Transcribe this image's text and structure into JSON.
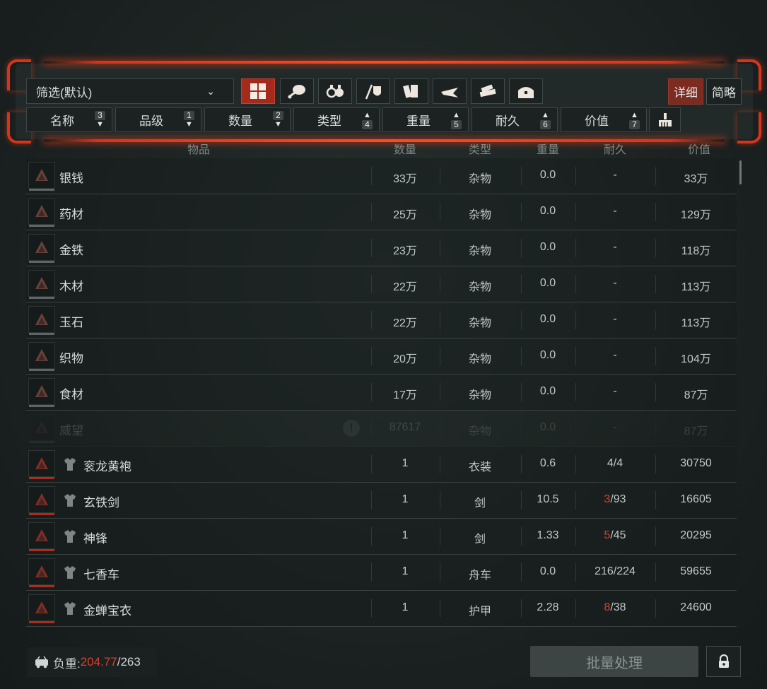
{
  "filter": {
    "selected": "筛选(默认)"
  },
  "categories": [
    {
      "icon": "all-grid-icon",
      "active": true
    },
    {
      "icon": "meat-icon",
      "active": false
    },
    {
      "icon": "potion-bottles-icon",
      "active": false
    },
    {
      "icon": "weapons-armor-icon",
      "active": false
    },
    {
      "icon": "books-scrolls-icon",
      "active": false
    },
    {
      "icon": "hidden-weapon-icon",
      "active": false
    },
    {
      "icon": "materials-icon",
      "active": false
    },
    {
      "icon": "treasure-chest-icon",
      "active": false
    }
  ],
  "view": {
    "detail": "详细",
    "brief": "简略",
    "active": "detail"
  },
  "sort_buttons": [
    {
      "label": "名称",
      "badge": "3",
      "badge_pos": "top",
      "arrow_pos": "bottom"
    },
    {
      "label": "品级",
      "badge": "1",
      "badge_pos": "top",
      "arrow_pos": "bottom"
    },
    {
      "label": "数量",
      "badge": "2",
      "badge_pos": "top",
      "arrow_pos": "bottom"
    },
    {
      "label": "类型",
      "badge": "4",
      "badge_pos": "bottom",
      "arrow_pos": "top"
    },
    {
      "label": "重量",
      "badge": "5",
      "badge_pos": "bottom",
      "arrow_pos": "top"
    },
    {
      "label": "耐久",
      "badge": "6",
      "badge_pos": "bottom",
      "arrow_pos": "top"
    },
    {
      "label": "价值",
      "badge": "7",
      "badge_pos": "bottom",
      "arrow_pos": "top"
    }
  ],
  "table": {
    "headers": {
      "item": "物品",
      "qty": "数量",
      "type": "类型",
      "weight": "重量",
      "durability": "耐久",
      "value": "价值"
    },
    "rows": [
      {
        "name": "银钱",
        "qty": "33万",
        "type": "杂物",
        "weight": "0.0",
        "dur_cur": "",
        "dur_rest": "-",
        "value": "33万",
        "equip": false,
        "dim": false,
        "red_bar": false
      },
      {
        "name": "药材",
        "qty": "25万",
        "type": "杂物",
        "weight": "0.0",
        "dur_cur": "",
        "dur_rest": "-",
        "value": "129万",
        "equip": false,
        "dim": false,
        "red_bar": false
      },
      {
        "name": "金铁",
        "qty": "23万",
        "type": "杂物",
        "weight": "0.0",
        "dur_cur": "",
        "dur_rest": "-",
        "value": "118万",
        "equip": false,
        "dim": false,
        "red_bar": false
      },
      {
        "name": "木材",
        "qty": "22万",
        "type": "杂物",
        "weight": "0.0",
        "dur_cur": "",
        "dur_rest": "-",
        "value": "113万",
        "equip": false,
        "dim": false,
        "red_bar": false
      },
      {
        "name": "玉石",
        "qty": "22万",
        "type": "杂物",
        "weight": "0.0",
        "dur_cur": "",
        "dur_rest": "-",
        "value": "113万",
        "equip": false,
        "dim": false,
        "red_bar": false
      },
      {
        "name": "织物",
        "qty": "20万",
        "type": "杂物",
        "weight": "0.0",
        "dur_cur": "",
        "dur_rest": "-",
        "value": "104万",
        "equip": false,
        "dim": false,
        "red_bar": false
      },
      {
        "name": "食材",
        "qty": "17万",
        "type": "杂物",
        "weight": "0.0",
        "dur_cur": "",
        "dur_rest": "-",
        "value": "87万",
        "equip": false,
        "dim": false,
        "red_bar": false
      },
      {
        "name": "威望",
        "qty": "87617",
        "type": "杂物",
        "weight": "0.0",
        "dur_cur": "",
        "dur_rest": "-",
        "value": "87万",
        "equip": false,
        "dim": true,
        "red_bar": false,
        "warning": "!"
      },
      {
        "name": "衮龙黄袍",
        "qty": "1",
        "type": "衣装",
        "weight": "0.6",
        "dur_cur": "",
        "dur_rest": "4/4",
        "value": "30750",
        "equip": true,
        "dim": false,
        "red_bar": true
      },
      {
        "name": "玄铁剑",
        "qty": "1",
        "type": "剑",
        "weight": "10.5",
        "dur_cur": "3",
        "dur_rest": "/93",
        "value": "16605",
        "equip": true,
        "dim": false,
        "red_bar": true
      },
      {
        "name": "神锋",
        "qty": "1",
        "type": "剑",
        "weight": "1.33",
        "dur_cur": "5",
        "dur_rest": "/45",
        "value": "20295",
        "equip": true,
        "dim": false,
        "red_bar": true
      },
      {
        "name": "七香车",
        "qty": "1",
        "type": "舟车",
        "weight": "0.0",
        "dur_cur": "",
        "dur_rest": "216/224",
        "value": "59655",
        "equip": true,
        "dim": false,
        "red_bar": true
      },
      {
        "name": "金蝉宝衣",
        "qty": "1",
        "type": "护甲",
        "weight": "2.28",
        "dur_cur": "8",
        "dur_rest": "/38",
        "value": "24600",
        "equip": true,
        "dim": false,
        "red_bar": true
      }
    ]
  },
  "footer": {
    "load_label": "负重:",
    "load_current": "204.77",
    "load_max": "/263",
    "batch_button": "批量处理"
  },
  "colors": {
    "accent_red": "#d8341c",
    "active_red": "#a62a1c",
    "text": "#c9cfcc"
  }
}
